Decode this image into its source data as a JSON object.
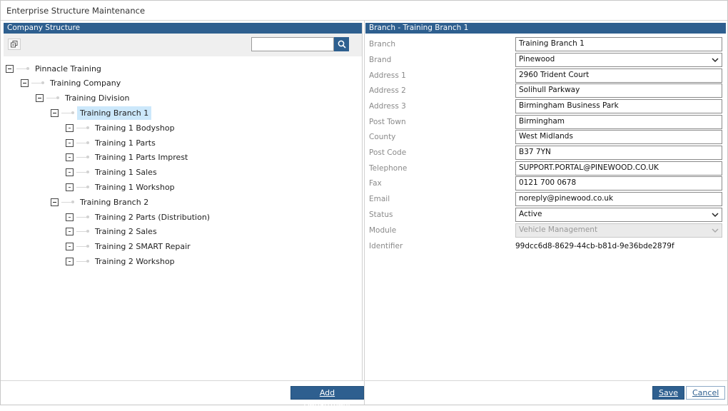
{
  "window": {
    "title": "Enterprise Structure Maintenance"
  },
  "left": {
    "header": "Company Structure",
    "search": {
      "value": "",
      "placeholder": ""
    },
    "tree": [
      {
        "label": "Pinnacle Training",
        "expander": "minus"
      },
      {
        "label": "Training Company",
        "expander": "minus"
      },
      {
        "label": "Training Division",
        "expander": "minus"
      },
      {
        "label": "Training Branch 1",
        "expander": "minus",
        "selected": true
      },
      {
        "label": "Training 1 Bodyshop",
        "expander": "leaf"
      },
      {
        "label": "Training 1 Parts",
        "expander": "leaf"
      },
      {
        "label": "Training 1 Parts Imprest",
        "expander": "leaf"
      },
      {
        "label": "Training 1 Sales",
        "expander": "leaf"
      },
      {
        "label": "Training 1 Workshop",
        "expander": "leaf"
      },
      {
        "label": "Training Branch 2",
        "expander": "minus"
      },
      {
        "label": "Training 2 Parts (Distribution)",
        "expander": "leaf"
      },
      {
        "label": "Training 2 Sales",
        "expander": "leaf"
      },
      {
        "label": "Training 2 SMART Repair",
        "expander": "leaf"
      },
      {
        "label": "Training 2 Workshop",
        "expander": "leaf"
      }
    ],
    "add_department_label": "Add Department"
  },
  "right": {
    "header": "Branch - Training Branch 1",
    "fields": {
      "branch": {
        "label": "Branch",
        "value": "Training Branch 1"
      },
      "brand": {
        "label": "Brand",
        "value": "Pinewood"
      },
      "address1": {
        "label": "Address 1",
        "value": "2960 Trident Court"
      },
      "address2": {
        "label": "Address 2",
        "value": "Solihull Parkway"
      },
      "address3": {
        "label": "Address 3",
        "value": "Birmingham Business Park"
      },
      "post_town": {
        "label": "Post Town",
        "value": "Birmingham"
      },
      "county": {
        "label": "County",
        "value": "West Midlands"
      },
      "post_code": {
        "label": "Post Code",
        "value": "B37 7YN"
      },
      "telephone": {
        "label": "Telephone",
        "value": "SUPPORT.PORTAL@PINEWOOD.CO.UK"
      },
      "fax": {
        "label": "Fax",
        "value": "0121 700 0678"
      },
      "email": {
        "label": "Email",
        "value": "noreply@pinewood.co.uk"
      },
      "status": {
        "label": "Status",
        "value": "Active"
      },
      "module": {
        "label": "Module",
        "value": "Vehicle Management"
      },
      "identifier": {
        "label": "Identifier",
        "value": "99dcc6d8-8629-44cb-b81d-9e36bde2879f"
      }
    },
    "save_label": "Save",
    "cancel_label": "Cancel"
  },
  "colors": {
    "accent": "#2e5f8f",
    "selected": "#cce8fb"
  }
}
